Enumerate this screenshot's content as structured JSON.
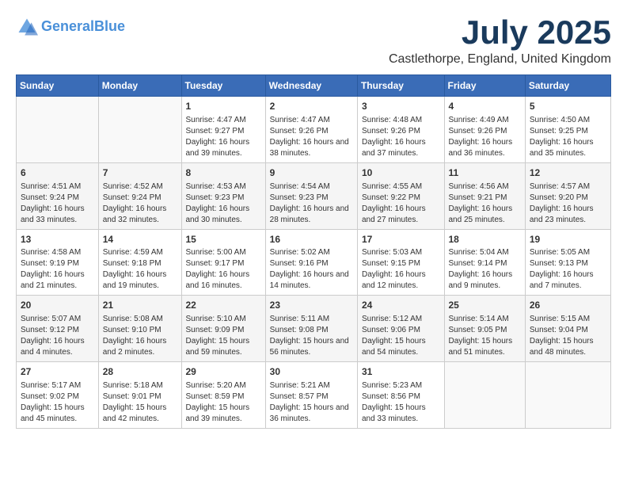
{
  "header": {
    "logo_line1": "General",
    "logo_line2": "Blue",
    "month": "July 2025",
    "location": "Castlethorpe, England, United Kingdom"
  },
  "days_of_week": [
    "Sunday",
    "Monday",
    "Tuesday",
    "Wednesday",
    "Thursday",
    "Friday",
    "Saturday"
  ],
  "weeks": [
    [
      {
        "day": "",
        "sunrise": "",
        "sunset": "",
        "daylight": ""
      },
      {
        "day": "",
        "sunrise": "",
        "sunset": "",
        "daylight": ""
      },
      {
        "day": "1",
        "sunrise": "Sunrise: 4:47 AM",
        "sunset": "Sunset: 9:27 PM",
        "daylight": "Daylight: 16 hours and 39 minutes."
      },
      {
        "day": "2",
        "sunrise": "Sunrise: 4:47 AM",
        "sunset": "Sunset: 9:26 PM",
        "daylight": "Daylight: 16 hours and 38 minutes."
      },
      {
        "day": "3",
        "sunrise": "Sunrise: 4:48 AM",
        "sunset": "Sunset: 9:26 PM",
        "daylight": "Daylight: 16 hours and 37 minutes."
      },
      {
        "day": "4",
        "sunrise": "Sunrise: 4:49 AM",
        "sunset": "Sunset: 9:26 PM",
        "daylight": "Daylight: 16 hours and 36 minutes."
      },
      {
        "day": "5",
        "sunrise": "Sunrise: 4:50 AM",
        "sunset": "Sunset: 9:25 PM",
        "daylight": "Daylight: 16 hours and 35 minutes."
      }
    ],
    [
      {
        "day": "6",
        "sunrise": "Sunrise: 4:51 AM",
        "sunset": "Sunset: 9:24 PM",
        "daylight": "Daylight: 16 hours and 33 minutes."
      },
      {
        "day": "7",
        "sunrise": "Sunrise: 4:52 AM",
        "sunset": "Sunset: 9:24 PM",
        "daylight": "Daylight: 16 hours and 32 minutes."
      },
      {
        "day": "8",
        "sunrise": "Sunrise: 4:53 AM",
        "sunset": "Sunset: 9:23 PM",
        "daylight": "Daylight: 16 hours and 30 minutes."
      },
      {
        "day": "9",
        "sunrise": "Sunrise: 4:54 AM",
        "sunset": "Sunset: 9:23 PM",
        "daylight": "Daylight: 16 hours and 28 minutes."
      },
      {
        "day": "10",
        "sunrise": "Sunrise: 4:55 AM",
        "sunset": "Sunset: 9:22 PM",
        "daylight": "Daylight: 16 hours and 27 minutes."
      },
      {
        "day": "11",
        "sunrise": "Sunrise: 4:56 AM",
        "sunset": "Sunset: 9:21 PM",
        "daylight": "Daylight: 16 hours and 25 minutes."
      },
      {
        "day": "12",
        "sunrise": "Sunrise: 4:57 AM",
        "sunset": "Sunset: 9:20 PM",
        "daylight": "Daylight: 16 hours and 23 minutes."
      }
    ],
    [
      {
        "day": "13",
        "sunrise": "Sunrise: 4:58 AM",
        "sunset": "Sunset: 9:19 PM",
        "daylight": "Daylight: 16 hours and 21 minutes."
      },
      {
        "day": "14",
        "sunrise": "Sunrise: 4:59 AM",
        "sunset": "Sunset: 9:18 PM",
        "daylight": "Daylight: 16 hours and 19 minutes."
      },
      {
        "day": "15",
        "sunrise": "Sunrise: 5:00 AM",
        "sunset": "Sunset: 9:17 PM",
        "daylight": "Daylight: 16 hours and 16 minutes."
      },
      {
        "day": "16",
        "sunrise": "Sunrise: 5:02 AM",
        "sunset": "Sunset: 9:16 PM",
        "daylight": "Daylight: 16 hours and 14 minutes."
      },
      {
        "day": "17",
        "sunrise": "Sunrise: 5:03 AM",
        "sunset": "Sunset: 9:15 PM",
        "daylight": "Daylight: 16 hours and 12 minutes."
      },
      {
        "day": "18",
        "sunrise": "Sunrise: 5:04 AM",
        "sunset": "Sunset: 9:14 PM",
        "daylight": "Daylight: 16 hours and 9 minutes."
      },
      {
        "day": "19",
        "sunrise": "Sunrise: 5:05 AM",
        "sunset": "Sunset: 9:13 PM",
        "daylight": "Daylight: 16 hours and 7 minutes."
      }
    ],
    [
      {
        "day": "20",
        "sunrise": "Sunrise: 5:07 AM",
        "sunset": "Sunset: 9:12 PM",
        "daylight": "Daylight: 16 hours and 4 minutes."
      },
      {
        "day": "21",
        "sunrise": "Sunrise: 5:08 AM",
        "sunset": "Sunset: 9:10 PM",
        "daylight": "Daylight: 16 hours and 2 minutes."
      },
      {
        "day": "22",
        "sunrise": "Sunrise: 5:10 AM",
        "sunset": "Sunset: 9:09 PM",
        "daylight": "Daylight: 15 hours and 59 minutes."
      },
      {
        "day": "23",
        "sunrise": "Sunrise: 5:11 AM",
        "sunset": "Sunset: 9:08 PM",
        "daylight": "Daylight: 15 hours and 56 minutes."
      },
      {
        "day": "24",
        "sunrise": "Sunrise: 5:12 AM",
        "sunset": "Sunset: 9:06 PM",
        "daylight": "Daylight: 15 hours and 54 minutes."
      },
      {
        "day": "25",
        "sunrise": "Sunrise: 5:14 AM",
        "sunset": "Sunset: 9:05 PM",
        "daylight": "Daylight: 15 hours and 51 minutes."
      },
      {
        "day": "26",
        "sunrise": "Sunrise: 5:15 AM",
        "sunset": "Sunset: 9:04 PM",
        "daylight": "Daylight: 15 hours and 48 minutes."
      }
    ],
    [
      {
        "day": "27",
        "sunrise": "Sunrise: 5:17 AM",
        "sunset": "Sunset: 9:02 PM",
        "daylight": "Daylight: 15 hours and 45 minutes."
      },
      {
        "day": "28",
        "sunrise": "Sunrise: 5:18 AM",
        "sunset": "Sunset: 9:01 PM",
        "daylight": "Daylight: 15 hours and 42 minutes."
      },
      {
        "day": "29",
        "sunrise": "Sunrise: 5:20 AM",
        "sunset": "Sunset: 8:59 PM",
        "daylight": "Daylight: 15 hours and 39 minutes."
      },
      {
        "day": "30",
        "sunrise": "Sunrise: 5:21 AM",
        "sunset": "Sunset: 8:57 PM",
        "daylight": "Daylight: 15 hours and 36 minutes."
      },
      {
        "day": "31",
        "sunrise": "Sunrise: 5:23 AM",
        "sunset": "Sunset: 8:56 PM",
        "daylight": "Daylight: 15 hours and 33 minutes."
      },
      {
        "day": "",
        "sunrise": "",
        "sunset": "",
        "daylight": ""
      },
      {
        "day": "",
        "sunrise": "",
        "sunset": "",
        "daylight": ""
      }
    ]
  ]
}
